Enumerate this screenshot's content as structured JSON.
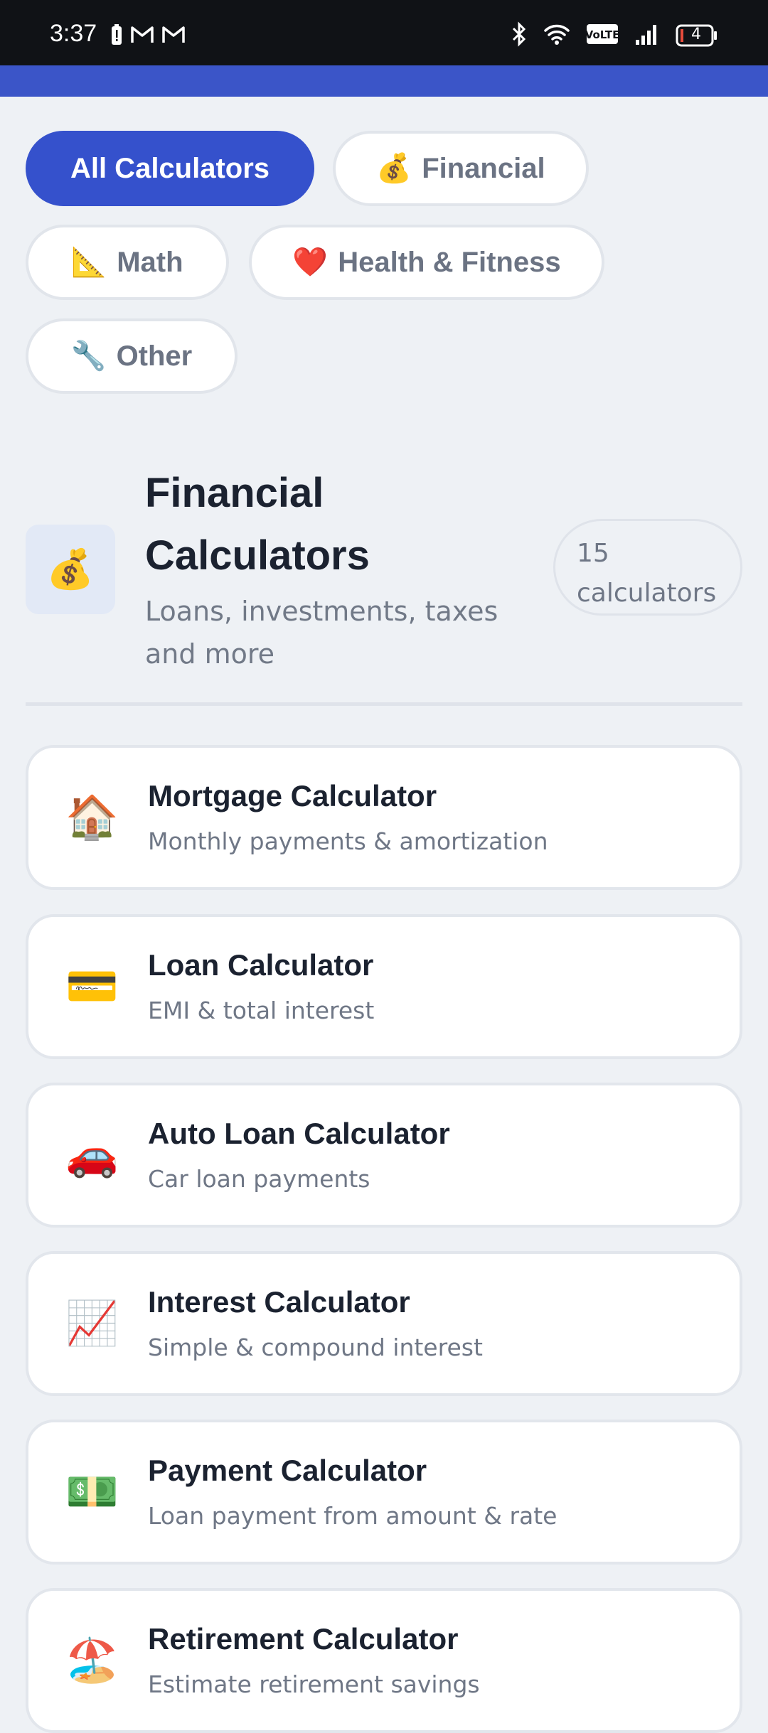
{
  "status_bar": {
    "time": "3:37",
    "battery_level": "4",
    "network_badge": "VoLTE",
    "left_icons": [
      "battery-alert-icon",
      "gmail-icon",
      "gmail-icon"
    ],
    "right_icons": [
      "bluetooth-icon",
      "wifi-icon",
      "volte-icon",
      "signal-icon",
      "battery-icon"
    ]
  },
  "chips": [
    {
      "label": "All Calculators",
      "emoji": "",
      "active": true
    },
    {
      "label": "Financial",
      "emoji": "💰",
      "active": false
    },
    {
      "label": "Math",
      "emoji": "📐",
      "active": false
    },
    {
      "label": "Health & Fitness",
      "emoji": "❤️",
      "active": false
    },
    {
      "label": "Other",
      "emoji": "🔧",
      "active": false
    }
  ],
  "section": {
    "icon": "💰",
    "title": "Financial Calculators",
    "subtitle": "Loans, investments, taxes and more",
    "count": "15 calculators"
  },
  "calculators": [
    {
      "icon": "🏠",
      "title": "Mortgage Calculator",
      "subtitle": "Monthly payments & amortization"
    },
    {
      "icon": "💳",
      "title": "Loan Calculator",
      "subtitle": "EMI & total interest"
    },
    {
      "icon": "🚗",
      "title": "Auto Loan Calculator",
      "subtitle": "Car loan payments"
    },
    {
      "icon": "📈",
      "title": "Interest Calculator",
      "subtitle": "Simple & compound interest"
    },
    {
      "icon": "💵",
      "title": "Payment Calculator",
      "subtitle": "Loan payment from amount & rate"
    },
    {
      "icon": "🏖️",
      "title": "Retirement Calculator",
      "subtitle": "Estimate retirement savings"
    }
  ],
  "colors": {
    "accent": "#3551cc",
    "background": "#eef1f5",
    "card": "#ffffff",
    "text_primary": "#1b2230",
    "text_secondary": "#6f7786"
  }
}
